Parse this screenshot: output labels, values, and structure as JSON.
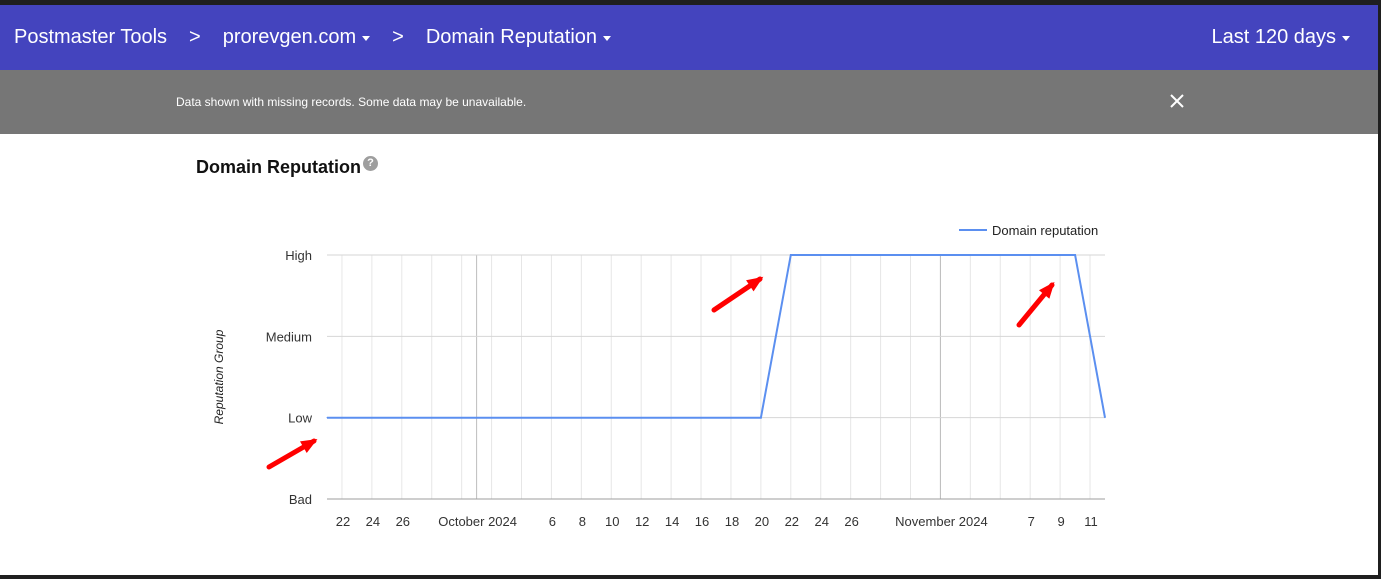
{
  "header": {
    "app_name": "Postmaster Tools",
    "separator": ">",
    "domain": "prorevgen.com",
    "page": "Domain Reputation",
    "date_range": "Last 120 days"
  },
  "banner": {
    "message": "Data shown with missing records. Some data may be unavailable."
  },
  "section": {
    "title": "Domain Reputation",
    "help_glyph": "?"
  },
  "colors": {
    "header_bg": "#4444be",
    "banner_bg": "#767676",
    "series_line": "#5b8ff0",
    "annotation_arrow": "#ff0000"
  },
  "chart_data": {
    "type": "line",
    "ylabel": "Reputation Group",
    "y_categories": [
      "Bad",
      "Low",
      "Medium",
      "High"
    ],
    "x_tick_labels": [
      "22",
      "24",
      "26",
      "October 2024",
      "6",
      "8",
      "10",
      "12",
      "14",
      "16",
      "18",
      "20",
      "22",
      "24",
      "26",
      "November 2024",
      "7",
      "9",
      "11"
    ],
    "legend_position": "top-right",
    "grid": true,
    "series": [
      {
        "name": "Domain reputation",
        "points": [
          {
            "x": "2024-09-21",
            "y": "Low"
          },
          {
            "x": "2024-10-20",
            "y": "Low"
          },
          {
            "x": "2024-10-22",
            "y": "High"
          },
          {
            "x": "2024-11-10",
            "y": "High"
          },
          {
            "x": "2024-11-12",
            "y": "Low"
          }
        ]
      }
    ]
  }
}
